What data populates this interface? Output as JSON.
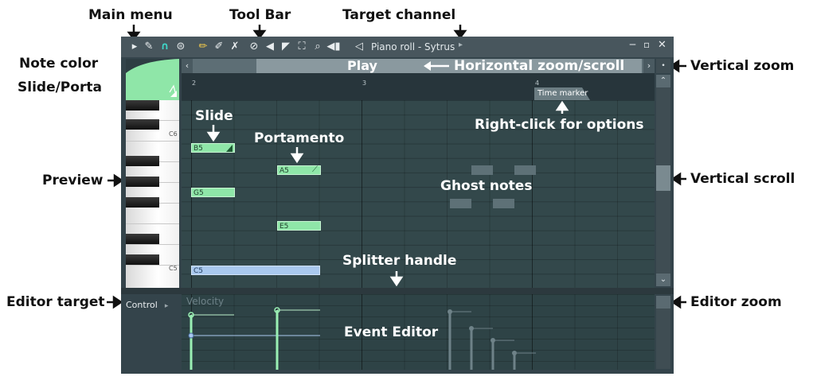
{
  "window": {
    "title": "Piano roll - Sytrus",
    "play_label": "Play",
    "controls": [
      "minimize-icon",
      "maximize-icon",
      "close-icon"
    ]
  },
  "toolbar": {
    "icons": [
      "menu-arrow-icon",
      "wrench-icon",
      "magnet-icon",
      "snap-menu-icon",
      "pencil-icon",
      "paint-brush-icon",
      "delete-icon",
      "mute-icon",
      "slice-icon",
      "select-icon",
      "zoom-icon",
      "playback-icon",
      "speaker-icon"
    ]
  },
  "timeline": {
    "bars": [
      "2",
      "3",
      "4"
    ],
    "marker": "Time marker"
  },
  "keyboard": {
    "labels": [
      "C6",
      "C5"
    ]
  },
  "notes": [
    {
      "label": "B5",
      "type": "slide"
    },
    {
      "label": "A5",
      "type": "portamento"
    },
    {
      "label": "G5",
      "type": "normal"
    },
    {
      "label": "E5",
      "type": "normal"
    },
    {
      "label": "C5",
      "type": "normal"
    }
  ],
  "event_editor": {
    "target": "Control",
    "parameter": "Velocity"
  },
  "annotations": {
    "main_menu": "Main menu",
    "tool_bar": "Tool Bar",
    "target_channel": "Target channel",
    "note_color": "Note color",
    "slide_porta": "Slide/Porta",
    "preview": "Preview",
    "editor_target": "Editor target",
    "horizontal_zoom": "Horizontal zoom/scroll",
    "vertical_zoom": "Vertical zoom",
    "right_click": "Right-click for options",
    "vertical_scroll": "Vertical scroll",
    "editor_zoom": "Editor zoom",
    "slide": "Slide",
    "portamento": "Portamento",
    "ghost_notes": "Ghost notes",
    "splitter_handle": "Splitter handle",
    "event_editor": "Event Editor"
  },
  "colors": {
    "note_green": "#8fe6a8",
    "note_blue": "#a9c8ee",
    "grid_bg": "#33484b",
    "panel_bg": "#34444b"
  }
}
